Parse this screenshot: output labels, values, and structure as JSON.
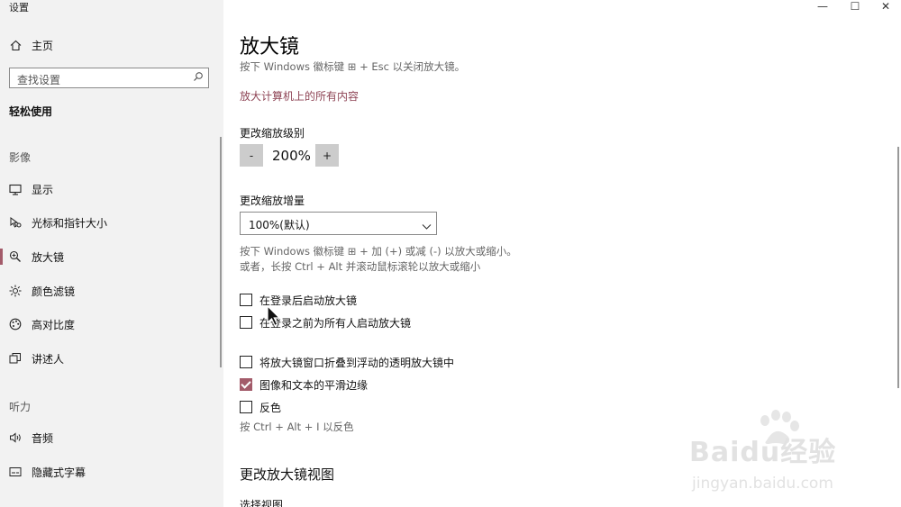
{
  "window": {
    "title": "设置",
    "controls": {
      "minimize": "—",
      "maximize": "☐",
      "close": "✕"
    }
  },
  "sidebar": {
    "home": {
      "icon": "home-icon",
      "label": "主页"
    },
    "search": {
      "placeholder": "查找设置",
      "icon": "search-icon"
    },
    "group_title": "轻松使用",
    "sections": [
      {
        "label": "影像",
        "items": [
          {
            "icon": "display-icon",
            "label": "显示"
          },
          {
            "icon": "cursor-icon",
            "label": "光标和指针大小"
          },
          {
            "icon": "magnifier-icon",
            "label": "放大镜",
            "active": true
          },
          {
            "icon": "color-filter-icon",
            "label": "颜色滤镜"
          },
          {
            "icon": "high-contrast-icon",
            "label": "高对比度"
          },
          {
            "icon": "narrator-icon",
            "label": "讲述人"
          }
        ]
      },
      {
        "label": "听力",
        "items": [
          {
            "icon": "audio-icon",
            "label": "音频"
          },
          {
            "icon": "captions-icon",
            "label": "隐藏式字幕"
          }
        ]
      }
    ]
  },
  "main": {
    "title": "放大镜",
    "hint_top": "按下 Windows 徽标键 ⊞ + Esc 以关闭放大镜。",
    "link": "放大计算机上的所有内容",
    "zoom": {
      "label": "更改缩放级别",
      "minus": "-",
      "value": "200%",
      "plus": "+"
    },
    "increment": {
      "label": "更改缩放增量",
      "selected": "100%(默认)"
    },
    "hint_keys_1": "按下 Windows 徽标键 ⊞ + 加 (+) 或减 (-) 以放大或缩小。",
    "hint_keys_2": "或者，长按 Ctrl + Alt 并滚动鼠标滚轮以放大或缩小",
    "checkboxes": [
      {
        "label": "在登录后启动放大镜",
        "checked": false
      },
      {
        "label": "在登录之前为所有人启动放大镜",
        "checked": false
      },
      {
        "label": "将放大镜窗口折叠到浮动的透明放大镜中",
        "checked": false
      },
      {
        "label": "图像和文本的平滑边缘",
        "checked": true
      },
      {
        "label": "反色",
        "checked": false
      }
    ],
    "invert_hint": "按 Ctrl + Alt + I 以反色",
    "view_heading": "更改放大镜视图",
    "view_label": "选择视图"
  },
  "watermark": {
    "brand": "Baidu经验",
    "url": "jingyan.baidu.com"
  },
  "colors": {
    "accent": "#a35b6a",
    "sidebar_bg": "#f2f2f2",
    "link": "#8e4455"
  }
}
